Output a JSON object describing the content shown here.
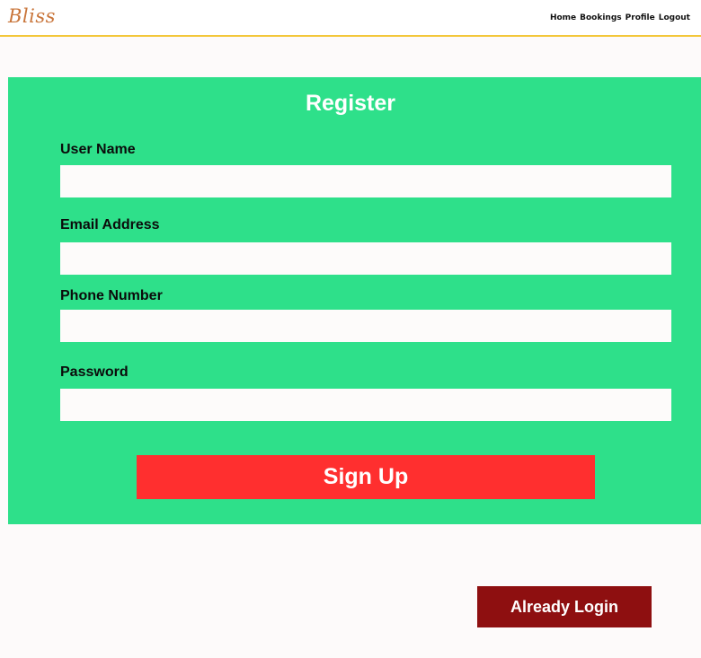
{
  "header": {
    "brand": "Bliss",
    "nav": [
      {
        "label": "Home"
      },
      {
        "label": "Bookings"
      },
      {
        "label": "Profile"
      },
      {
        "label": "Logout"
      }
    ]
  },
  "form": {
    "title": "Register",
    "fields": [
      {
        "label": "User Name",
        "value": ""
      },
      {
        "label": "Email Address",
        "value": ""
      },
      {
        "label": "Phone Number",
        "value": ""
      },
      {
        "label": "Password",
        "value": ""
      }
    ],
    "submit_label": "Sign Up"
  },
  "footer": {
    "login_label": "Already Login"
  },
  "colors": {
    "accent_border": "#f3c73a",
    "brand": "#c9753a",
    "panel": "#2ee08a",
    "signup": "#ff2f2f",
    "login": "#8e0f10"
  }
}
